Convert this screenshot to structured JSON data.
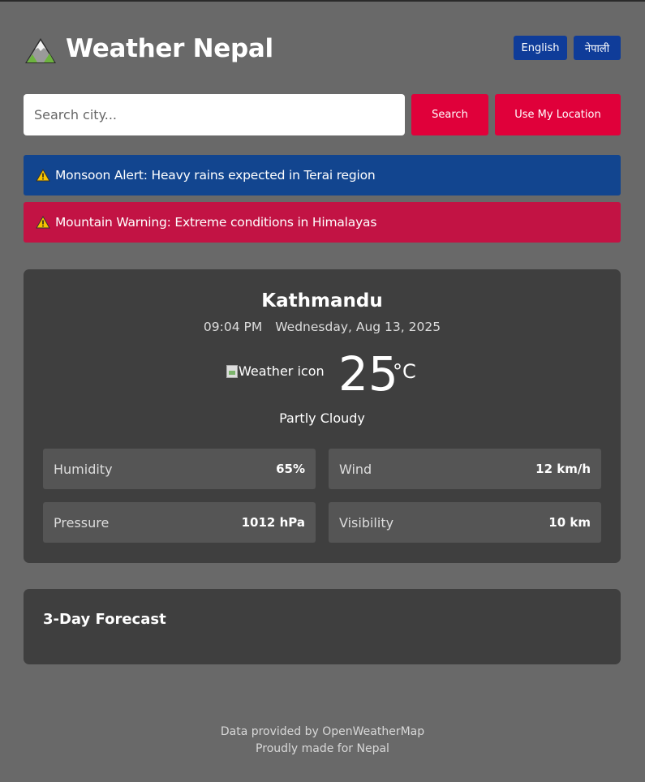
{
  "header": {
    "title": "Weather Nepal",
    "logo_icon": "mountain-icon",
    "lang_english": "English",
    "lang_nepali": "नेपाली"
  },
  "search": {
    "placeholder": "Search city...",
    "value": "",
    "search_label": "Search",
    "location_label": "Use My Location"
  },
  "alerts": [
    {
      "icon": "warning-icon",
      "text": "Monsoon Alert: Heavy rains expected in Terai region",
      "color": "#12458f"
    },
    {
      "icon": "warning-icon",
      "text": "Mountain Warning: Extreme conditions in Himalayas",
      "color": "#c21344"
    }
  ],
  "current": {
    "city": "Kathmandu",
    "time": "09:04 PM",
    "date": "Wednesday, Aug 13, 2025",
    "icon_alt": "Weather icon",
    "temperature": "25",
    "unit": "°C",
    "condition": "Partly Cloudy",
    "stats": {
      "humidity": {
        "label": "Humidity",
        "value": "65%"
      },
      "wind": {
        "label": "Wind",
        "value": "12 km/h"
      },
      "pressure": {
        "label": "Pressure",
        "value": "1012 hPa"
      },
      "visibility": {
        "label": "Visibility",
        "value": "10 km"
      }
    }
  },
  "forecast": {
    "title": "3-Day Forecast"
  },
  "footer": {
    "line1": "Data provided by OpenWeatherMap",
    "line2": "Proudly made for Nepal"
  },
  "colors": {
    "background": "#696969",
    "card": "#3f3f3f",
    "accent_red": "#e0003a",
    "accent_blue": "#0f3c99"
  }
}
